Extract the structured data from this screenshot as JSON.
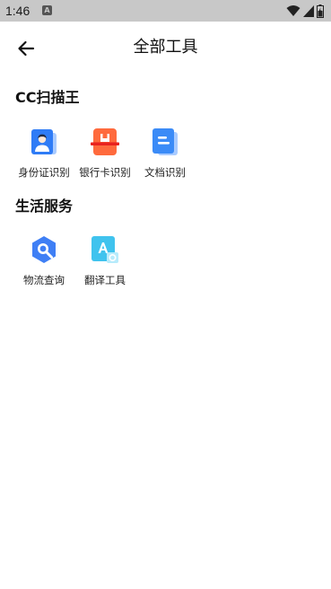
{
  "status_bar": {
    "time": "1:46",
    "notification_icon": "a-notification-icon",
    "wifi_icon": "wifi-icon",
    "signal_icon": "signal-icon",
    "battery_icon": "battery-icon"
  },
  "header": {
    "back_icon": "arrow-left-icon",
    "title": "全部工具"
  },
  "sections": [
    {
      "title": "CC扫描王",
      "tools": [
        {
          "label": "身份证识别",
          "icon": "id-card-icon"
        },
        {
          "label": "银行卡识别",
          "icon": "bank-card-icon"
        },
        {
          "label": "文档识别",
          "icon": "document-icon"
        }
      ]
    },
    {
      "title": "生活服务",
      "tools": [
        {
          "label": "物流查询",
          "icon": "logistics-search-icon"
        },
        {
          "label": "翻译工具",
          "icon": "translate-icon"
        }
      ]
    }
  ],
  "colors": {
    "status_bar_bg": "#c8c8c8",
    "id_card_blue": "#2f7cf6",
    "bank_card_orange": "#ff6a3d",
    "bank_card_red_stripe": "#e8231f",
    "document_blue": "#3b8bf7",
    "logistics_blue": "#3f7ff5",
    "translate_cyan": "#40c3ee"
  }
}
